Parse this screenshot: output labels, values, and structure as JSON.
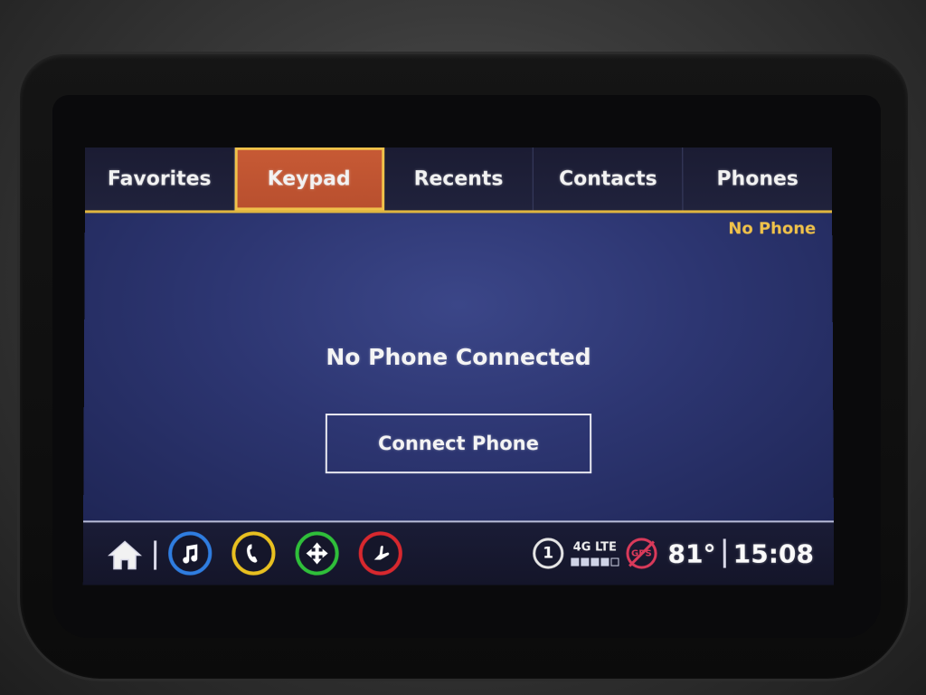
{
  "tabs": [
    {
      "label": "Favorites",
      "active": false
    },
    {
      "label": "Keypad",
      "active": true
    },
    {
      "label": "Recents",
      "active": false
    },
    {
      "label": "Contacts",
      "active": false
    },
    {
      "label": "Phones",
      "active": false
    }
  ],
  "phone_status": "No Phone",
  "main": {
    "title": "No Phone Connected",
    "connect_button": "Connect Phone"
  },
  "statusbar": {
    "apps": [
      {
        "name": "audio",
        "icon": "music-note-icon",
        "color": "#2f7de0"
      },
      {
        "name": "phone",
        "icon": "phone-icon",
        "color": "#e8c020"
      },
      {
        "name": "navigation",
        "icon": "nav-arrows-icon",
        "color": "#2fbf3a"
      },
      {
        "name": "settings",
        "icon": "seat-icon",
        "color": "#d8282e"
      }
    ],
    "notification_count": "1",
    "network": "4G LTE",
    "signal_bars": 4,
    "gps": "GPS",
    "temperature": "81°",
    "time": "15:08"
  },
  "colors": {
    "accent": "#f0c24a",
    "active_tab": "#c75a35",
    "screen_bg": "#2d3672"
  }
}
